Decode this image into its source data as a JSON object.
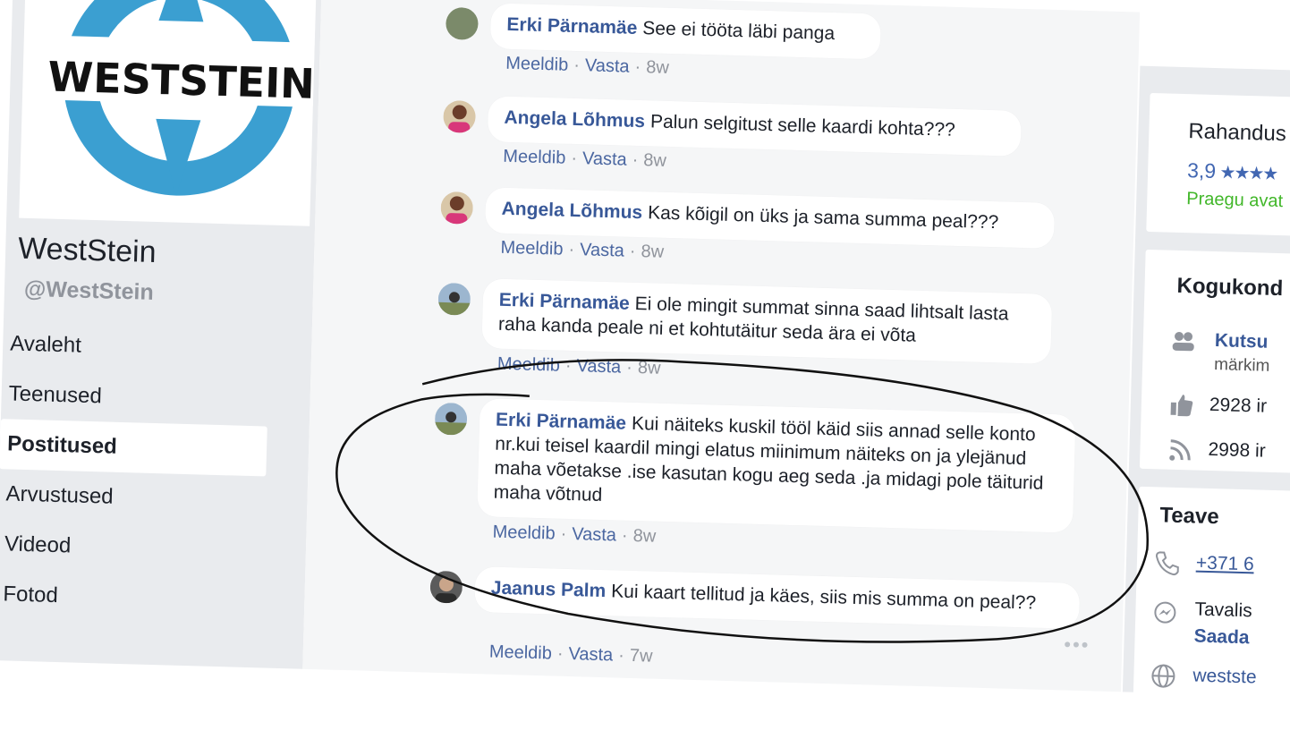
{
  "logo": {
    "text": "WESTSTEIN",
    "colors": {
      "ring": "#3b9fd1",
      "text": "#111111"
    }
  },
  "page": {
    "name": "WestStein",
    "handle": "@WestStein"
  },
  "nav": [
    {
      "label": "Avaleht"
    },
    {
      "label": "Teenused"
    },
    {
      "label": "Postitused",
      "active": true
    },
    {
      "label": "Arvustused"
    },
    {
      "label": "Videod"
    },
    {
      "label": "Fotod"
    }
  ],
  "actions": {
    "like": "Meeldib",
    "reply": "Vasta"
  },
  "comments": [
    {
      "author": "Erki Pärnamäe",
      "text": "See ei tööta läbi panga",
      "time": "8w"
    },
    {
      "author": "Angela Lõhmus",
      "text": "Palun selgitust selle kaardi kohta???",
      "time": "8w"
    },
    {
      "author": "Angela Lõhmus",
      "text": "Kas kõigil on üks ja sama summa peal???",
      "time": "8w"
    },
    {
      "author": "Erki Pärnamäe",
      "text": "Ei ole mingit summat sinna saad lihtsalt lasta raha kanda peale ni et kohtutäitur seda ära ei võta",
      "time": "8w"
    },
    {
      "author": "Erki Pärnamäe",
      "text": "Kui näiteks kuskil tööl käid siis annad selle konto nr.kui teisel kaardil mingi elatus miinimum näiteks on ja ylejänud maha võetakse .ise kasutan kogu aeg seda .ja midagi pole täiturid maha võtnud",
      "time": "8w"
    },
    {
      "author": "Jaanus Palm",
      "text": "Kui kaart tellitud ja käes, siis mis summa on peal??",
      "time": "7w"
    }
  ],
  "sidebar_right": {
    "category": "Rahandus",
    "rating": "3,9",
    "stars": "★★★★",
    "status": "Praegu avat",
    "community": {
      "title": "Kogukond",
      "invite_link": "Kutsu",
      "invite_sub": "märkim",
      "likes": "2928 ir",
      "follows": "2998 ir"
    },
    "about": {
      "title": "Teave",
      "phone": "+371 6",
      "messenger_line1": "Tavalis",
      "messenger_link": "Saada",
      "website": "westste"
    }
  }
}
